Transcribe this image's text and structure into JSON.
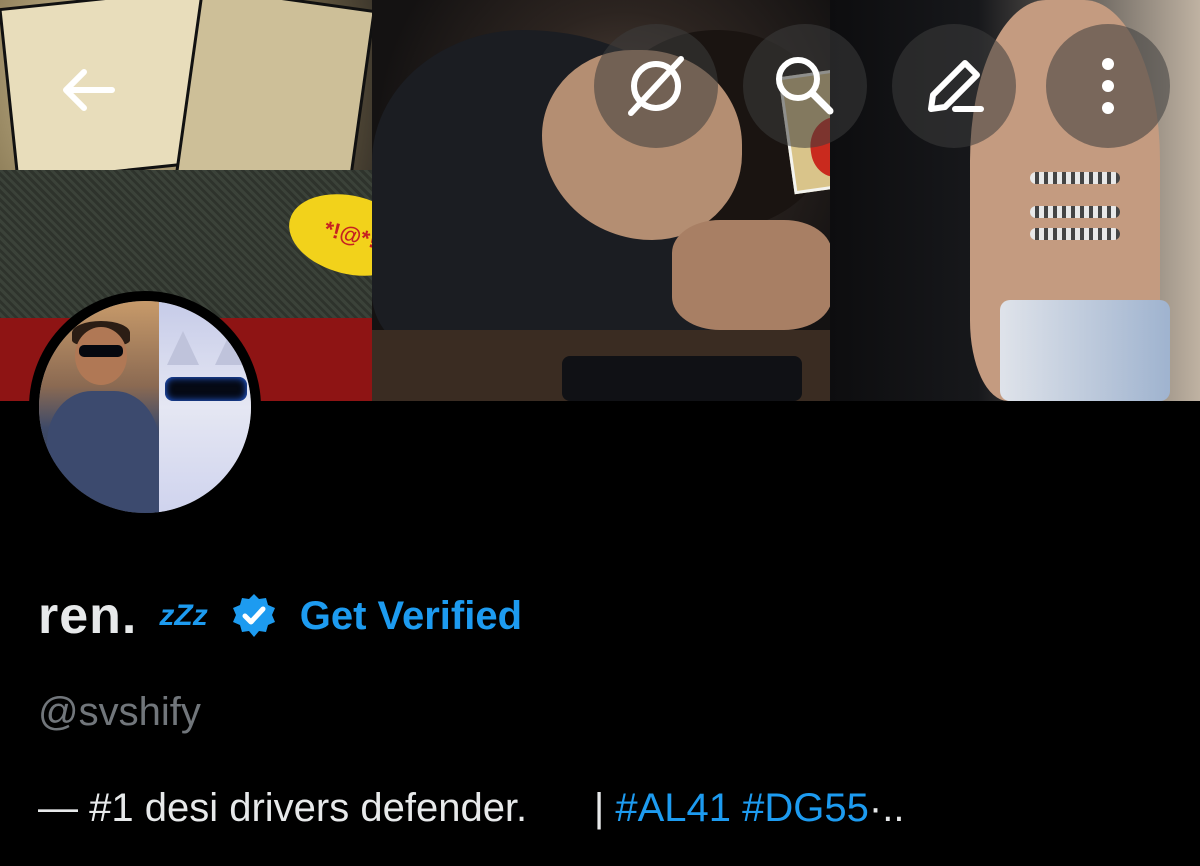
{
  "header": {
    "back_icon": "back-arrow-icon",
    "grok_icon": "grok-icon",
    "search_icon": "search-icon",
    "edit_icon": "edit-pencil-icon",
    "more_icon": "more-vertical-icon"
  },
  "banner": {
    "speech_bubble_text": "*!@*!"
  },
  "profile": {
    "display_name": "ren.",
    "name_emoji": "zZz",
    "verified_badge_icon": "verified-badge-icon",
    "get_verified_label": "Get Verified",
    "handle": "@svshify",
    "bio_text": "— #1 desi drivers defender.",
    "bio_separator": "|",
    "bio_hashtags": [
      "#AL41",
      "#DG55"
    ],
    "bio_suffix": "·.."
  },
  "colors": {
    "background": "#000000",
    "accent": "#1d9bf0",
    "primary_text": "#e7e9ea",
    "secondary_text": "#71767b"
  }
}
